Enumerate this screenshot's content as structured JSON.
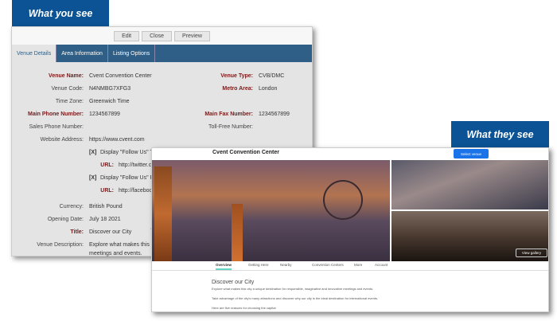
{
  "labels": {
    "you": "What you see",
    "they": "What they see"
  },
  "admin": {
    "toolbar": [
      "Edit",
      "Close",
      "Preview"
    ],
    "tabs": [
      "Venue Details",
      "Area Information",
      "Listing Options"
    ],
    "fields": {
      "venue_name": {
        "label": "Venue Name:",
        "value": "Cvent Convention Center"
      },
      "venue_type": {
        "label": "Venue Type:",
        "value": "CVB/DMC"
      },
      "venue_code": {
        "label": "Venue Code:",
        "value": "N4NMBG7XFG3"
      },
      "metro_area": {
        "label": "Metro Area:",
        "value": "London"
      },
      "time_zone": {
        "label": "Time Zone:",
        "value": "Greenwich Time"
      },
      "main_phone": {
        "label": "Main Phone Number:",
        "value": "1234567899"
      },
      "main_fax": {
        "label": "Main Fax Number:",
        "value": "1234567899"
      },
      "sales_phone": {
        "label": "Sales Phone Number:",
        "value": ""
      },
      "toll_free": {
        "label": "Toll-Free Number:",
        "value": ""
      },
      "website": {
        "label": "Website Address:",
        "value": "https://www.cvent.com"
      },
      "follow1": {
        "check": "[X]",
        "text": "Display \"Follow Us\" T",
        "url_label": "URL:",
        "url": "http://twitter.c"
      },
      "follow2": {
        "check": "[X]",
        "text": "Display \"Follow Us\" F",
        "url_label": "URL:",
        "url": "http://faceboo"
      },
      "currency": {
        "label": "Currency:",
        "value": "British Pound"
      },
      "opening_date": {
        "label": "Opening Date:",
        "value": "July 18 2021"
      },
      "title": {
        "label": "Title:",
        "value": "Discover our City",
        "help": "?"
      },
      "description": {
        "label": "Venue Description:",
        "value": "Explore what makes this c",
        "value2": "meetings and events."
      }
    }
  },
  "site": {
    "title": "Cvent Convention Center",
    "select_button": "Select venue",
    "gallery_button": "View gallery",
    "tabs": [
      "Overview",
      "Getting Here",
      "Nearby",
      "Convention Centers",
      "More",
      "Account"
    ],
    "heading": "Discover our City",
    "paragraphs": [
      "Explore what makes this city a unique destination for responsible, imaginative and innovative meetings and events.",
      "Take advantage of the city's many attractions and discover why our city is the ideal destination for international events.",
      "Here are five reasons for choosing the capital"
    ]
  }
}
